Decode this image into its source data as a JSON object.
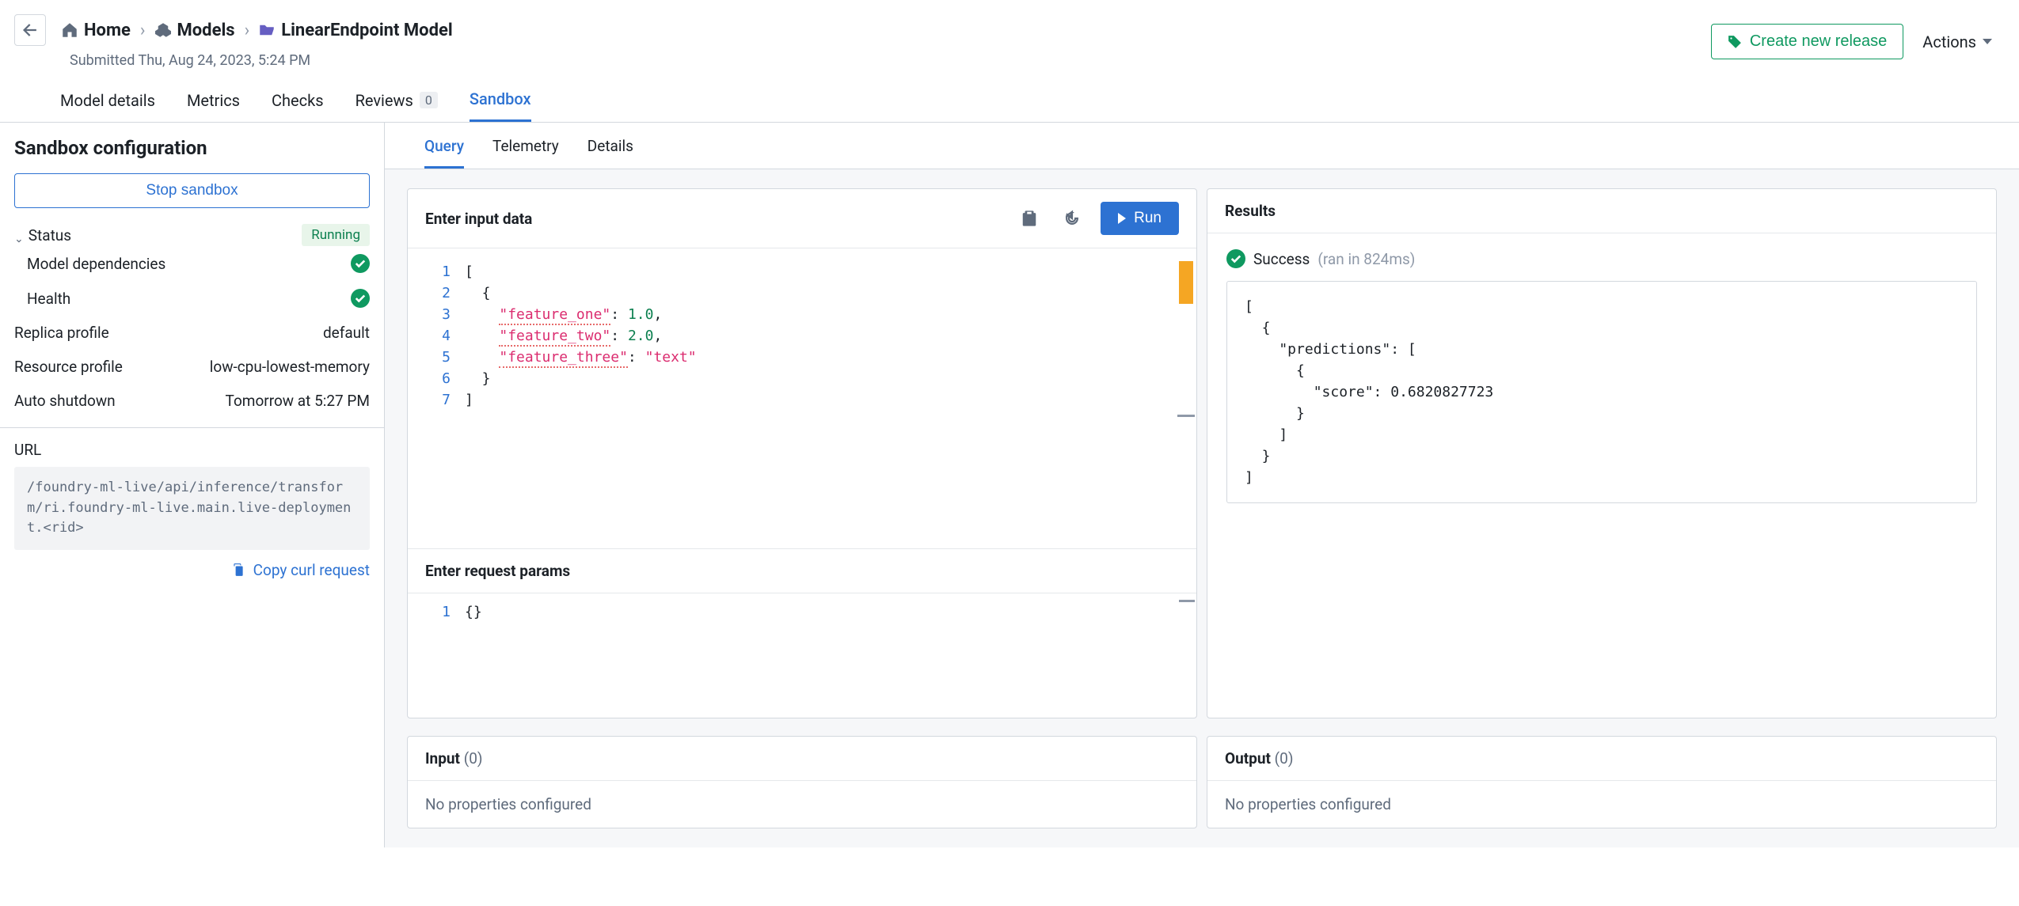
{
  "breadcrumbs": {
    "home": "Home",
    "models": "Models",
    "current": "LinearEndpoint Model"
  },
  "submitted_text": "Submitted Thu, Aug 24, 2023, 5:24 PM",
  "header_actions": {
    "create_release": "Create new release",
    "actions": "Actions"
  },
  "top_tabs": {
    "model_details": "Model details",
    "metrics": "Metrics",
    "checks": "Checks",
    "reviews": "Reviews",
    "reviews_count": "0",
    "sandbox": "Sandbox"
  },
  "sidebar": {
    "title": "Sandbox configuration",
    "stop_btn": "Stop sandbox",
    "status_label": "Status",
    "status_value": "Running",
    "items": {
      "model_deps": "Model dependencies",
      "health": "Health",
      "replica_profile_label": "Replica profile",
      "replica_profile_value": "default",
      "resource_profile_label": "Resource profile",
      "resource_profile_value": "low-cpu-lowest-memory",
      "auto_shutdown_label": "Auto shutdown",
      "auto_shutdown_value": "Tomorrow at 5:27 PM"
    },
    "url_label": "URL",
    "url_value": "/foundry-ml-live/api/inference/transform/ri.foundry-ml-live.main.live-deployment.<rid>",
    "copy_curl": "Copy curl request"
  },
  "sub_tabs": {
    "query": "Query",
    "telemetry": "Telemetry",
    "details": "Details"
  },
  "query_panel": {
    "input_title": "Enter input data",
    "run_label": "Run",
    "input_code": {
      "line_numbers": [
        "1",
        "2",
        "3",
        "4",
        "5",
        "6",
        "7"
      ],
      "content_raw": "[\n  {\n    \"feature_one\": 1.0,\n    \"feature_two\": 2.0,\n    \"feature_three\": \"text\"\n  }\n]",
      "parsed": [
        {
          "feature_one": 1.0,
          "feature_two": 2.0,
          "feature_three": "text"
        }
      ]
    },
    "params_title": "Enter request params",
    "params_code": {
      "line_numbers": [
        "1"
      ],
      "content_raw": "{}"
    }
  },
  "results_panel": {
    "title": "Results",
    "status_label": "Success",
    "ran_text": "(ran in 824ms)",
    "output_raw": "[\n  {\n    \"predictions\": [\n      {\n        \"score\": 0.6820827723\n      }\n    ]\n  }\n]",
    "output_parsed": [
      {
        "predictions": [
          {
            "score": 0.6820827723
          }
        ]
      }
    ]
  },
  "io_panels": {
    "input_label": "Input",
    "input_count": "(0)",
    "input_body": "No properties configured",
    "output_label": "Output",
    "output_count": "(0)",
    "output_body": "No properties configured"
  }
}
